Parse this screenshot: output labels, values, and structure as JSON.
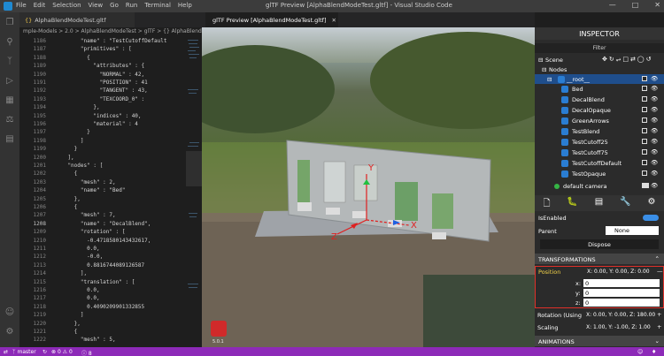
{
  "titlebar": {
    "menu": [
      "File",
      "Edit",
      "Selection",
      "View",
      "Go",
      "Run",
      "Terminal",
      "Help"
    ],
    "title": "glTF Preview [AlphaBlendModeTest.gltf] - Visual Studio Code"
  },
  "tabs": {
    "editor_tab": "AlphaBlendModeTest.gltf",
    "preview_tab": "glTF Preview [AlphaBlendModeTest.gltf]"
  },
  "breadcrumb": "mple-Models > 2.0 > AlphaBlendModeTest > glTF > {} AlphaBlendModeTest.gltf",
  "code_lines": [
    {
      "n": "1186",
      "t": "        \"name\" : \"TestCutoffDefault"
    },
    {
      "n": "1187",
      "t": "        \"primitives\" : ["
    },
    {
      "n": "1188",
      "t": "          {"
    },
    {
      "n": "1189",
      "t": "            \"attributes\" : {"
    },
    {
      "n": "1190",
      "t": "              \"NORMAL\" : 42,"
    },
    {
      "n": "1191",
      "t": "              \"POSITION\" : 41"
    },
    {
      "n": "1192",
      "t": "              \"TANGENT\" : 43,"
    },
    {
      "n": "1193",
      "t": "              \"TEXCOORD_0\" :"
    },
    {
      "n": "1194",
      "t": "            },"
    },
    {
      "n": "1195",
      "t": "            \"indices\" : 40,"
    },
    {
      "n": "1196",
      "t": "            \"material\" : 4"
    },
    {
      "n": "1197",
      "t": "          }"
    },
    {
      "n": "1198",
      "t": "        ]"
    },
    {
      "n": "1199",
      "t": "      }"
    },
    {
      "n": "1200",
      "t": "    ],"
    },
    {
      "n": "1201",
      "t": "    \"nodes\" : ["
    },
    {
      "n": "1202",
      "t": "      {"
    },
    {
      "n": "1203",
      "t": "        \"mesh\" : 2,"
    },
    {
      "n": "1204",
      "t": "        \"name\" : \"Bed\""
    },
    {
      "n": "1205",
      "t": "      },"
    },
    {
      "n": "1206",
      "t": "      {"
    },
    {
      "n": "1207",
      "t": "        \"mesh\" : 7,"
    },
    {
      "n": "1208",
      "t": "        \"name\" : \"DecalBlend\","
    },
    {
      "n": "1209",
      "t": "        \"rotation\" : ["
    },
    {
      "n": "1210",
      "t": "          -0.4718580143432617,"
    },
    {
      "n": "1211",
      "t": "          0.0,"
    },
    {
      "n": "1212",
      "t": "          -0.0,"
    },
    {
      "n": "1213",
      "t": "          0.8816744089126587"
    },
    {
      "n": "1214",
      "t": "        ],"
    },
    {
      "n": "1215",
      "t": "        \"translation\" : ["
    },
    {
      "n": "1216",
      "t": "          0.0,"
    },
    {
      "n": "1217",
      "t": "          0.0,"
    },
    {
      "n": "1218",
      "t": "          0.4090209901332855"
    },
    {
      "n": "1219",
      "t": "        ]"
    },
    {
      "n": "1220",
      "t": "      },"
    },
    {
      "n": "1221",
      "t": "      {"
    },
    {
      "n": "1222",
      "t": "        \"mesh\" : 5,"
    }
  ],
  "viewport": {
    "axis_x": "X",
    "axis_y": "Y",
    "axis_z": "Z",
    "version": "5.0.1"
  },
  "inspector": {
    "title": "INSPECTOR",
    "filter": "Filter",
    "scene": "Scene",
    "nodes": "Nodes",
    "root": "__root__",
    "node_items": [
      "Bed",
      "DecalBlend",
      "DecalOpaque",
      "GreenArrows",
      "TestBlend",
      "TestCutoff25",
      "TestCutoff75",
      "TestCutoffDefault",
      "TestOpaque"
    ],
    "camera": "default camera",
    "is_enabled": "IsEnabled",
    "parent": "Parent",
    "parent_value": "None",
    "dispose": "Dispose",
    "transformations": "TRANSFORMATIONS",
    "position_label": "Position",
    "position_value": "X: 0.00, Y: 0.00, Z: 0.00",
    "x_label": "x:",
    "y_label": "y:",
    "z_label": "z:",
    "x_val": "0",
    "y_val": "0",
    "z_val": "0",
    "rotation_label": "Rotation (Using",
    "rotation_value": "X: 0.00, Y: 0.00, Z: 180.00",
    "scaling_label": "Scaling",
    "scaling_value": "X: 1.00, Y: -1.00, Z: 1.00",
    "animations": "ANIMATIONS"
  },
  "status": {
    "branch": "master",
    "problems": "0 ⚠ 0",
    "info": "8"
  },
  "colors": {
    "accent": "#8d2ab8",
    "selection": "#1f4e8c",
    "highlight_border": "#e0302a"
  }
}
